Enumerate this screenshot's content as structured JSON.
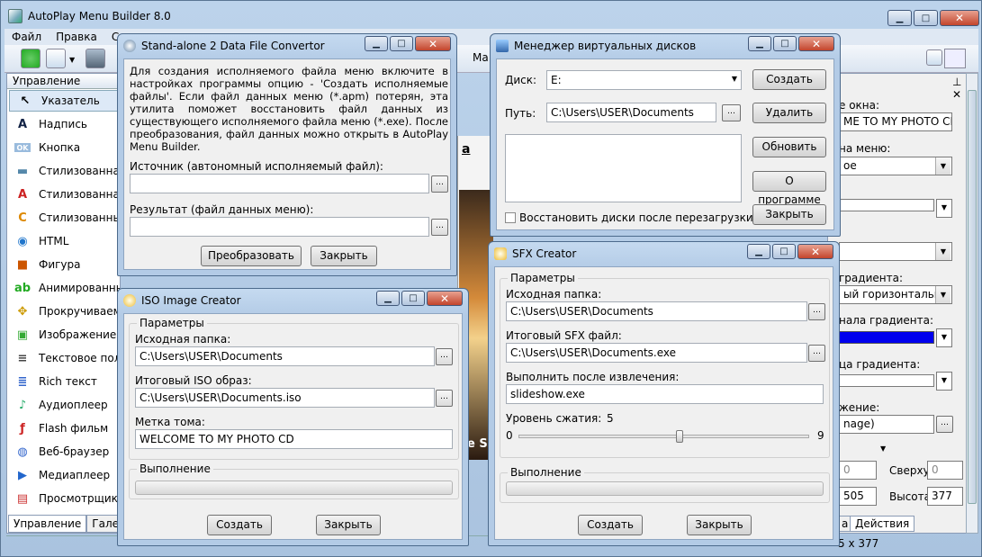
{
  "app": {
    "title": "AutoPlay Menu Builder 8.0",
    "menu": [
      "Файл",
      "Правка",
      "Стр"
    ],
    "left_panel_header": "Управление",
    "tools": [
      {
        "label": "Указатель",
        "icon": "pointer-icon"
      },
      {
        "label": "Надпись",
        "icon": "text-a-icon"
      },
      {
        "label": "Кнопка",
        "icon": "button-ok-icon"
      },
      {
        "label": "Стилизованная к",
        "icon": "styled-button-icon"
      },
      {
        "label": "Стилизованная н",
        "icon": "styled-text-icon"
      },
      {
        "label": "Стилизованный",
        "icon": "cool-text-icon"
      },
      {
        "label": "HTML",
        "icon": "globe-icon"
      },
      {
        "label": "Фигура",
        "icon": "shapes-icon"
      },
      {
        "label": "Анимированный",
        "icon": "abc-icon"
      },
      {
        "label": "Прокручиваем",
        "icon": "scroll-icon"
      },
      {
        "label": "Изображение",
        "icon": "image-icon"
      },
      {
        "label": "Текстовое поле",
        "icon": "textbox-icon"
      },
      {
        "label": "Rich текст",
        "icon": "richtext-icon"
      },
      {
        "label": "Аудиоплеер",
        "icon": "audio-icon"
      },
      {
        "label": "Flash фильм",
        "icon": "flash-icon"
      },
      {
        "label": "Веб-браузер",
        "icon": "browser-icon"
      },
      {
        "label": "Медиаплеер",
        "icon": "media-icon"
      },
      {
        "label": "Просмотрщик Р",
        "icon": "pdf-icon"
      }
    ],
    "left_tabs": [
      "Управление",
      "Галере"
    ],
    "right": {
      "texts": [
        "е окна:",
        "ME TO MY PHOTO CD",
        "на меню:",
        "ое",
        "градиента:",
        "ый горизонтальны",
        "нала градиента:",
        "ца градиента:",
        "жение:",
        "nage)"
      ],
      "top_label": "Сверху:",
      "top_value": "0",
      "h_label": "Высота:",
      "h_value": "377",
      "x_value": "0",
      "w_value": "505",
      "tab_actions": "Действия",
      "tab_a": "а",
      "size": "5 x 377"
    }
  },
  "convertor": {
    "title": "Stand-alone 2 Data File Convertor",
    "desc": "Для создания исполняемого файла меню включите в настройках программы опцию - 'Создать исполняемые файлы'. Если файл данных меню (*.apm) потерян, эта утилита поможет восстановить файл данных из существующего исполняемого файла меню (*.exe). После преобразования, файл данных можно открыть в AutoPlay Menu Builder.",
    "src_label": "Источник (автономный исполняемый файл):",
    "src_value": "",
    "dst_label": "Результат (файл данных меню):",
    "dst_value": "",
    "convert": "Преобразовать",
    "close": "Закрыть"
  },
  "vdisk": {
    "title": "Менеджер виртуальных дисков",
    "disk_label": "Диск:",
    "disk_value": "E:",
    "path_label": "Путь:",
    "path_value": "C:\\Users\\USER\\Documents",
    "create": "Создать",
    "delete": "Удалить",
    "refresh": "Обновить",
    "about": "О программе",
    "close": "Закрыть",
    "restore": "Восстановить диски после перезагрузки"
  },
  "iso": {
    "title": "ISO Image Creator",
    "group": "Параметры",
    "src_label": "Исходная папка:",
    "src_value": "C:\\Users\\USER\\Documents",
    "out_label": "Итоговый ISO образ:",
    "out_value": "C:\\Users\\USER\\Documents.iso",
    "vol_label": "Метка тома:",
    "vol_value": "WELCOME TO MY PHOTO CD",
    "progress_group": "Выполнение",
    "progress": 0,
    "create": "Создать",
    "close": "Закрыть"
  },
  "sfx": {
    "title": "SFX Creator",
    "group": "Параметры",
    "src_label": "Исходная папка:",
    "src_value": "C:\\Users\\USER\\Documents",
    "out_label": "Итоговый SFX файл:",
    "out_value": "C:\\Users\\USER\\Documents.exe",
    "run_label": "Выполнить после извлечения:",
    "run_value": "slideshow.exe",
    "comp_label": "Уровень сжатия:",
    "comp_value": "5",
    "comp_min": "0",
    "comp_max": "9",
    "comp_fraction": 0.556,
    "progress_group": "Выполнение",
    "progress": 0,
    "create": "Создать",
    "close": "Закрыть"
  },
  "misc": {
    "ma": "Ма",
    "bg_text1": "a",
    "bg_text2": "e S"
  }
}
